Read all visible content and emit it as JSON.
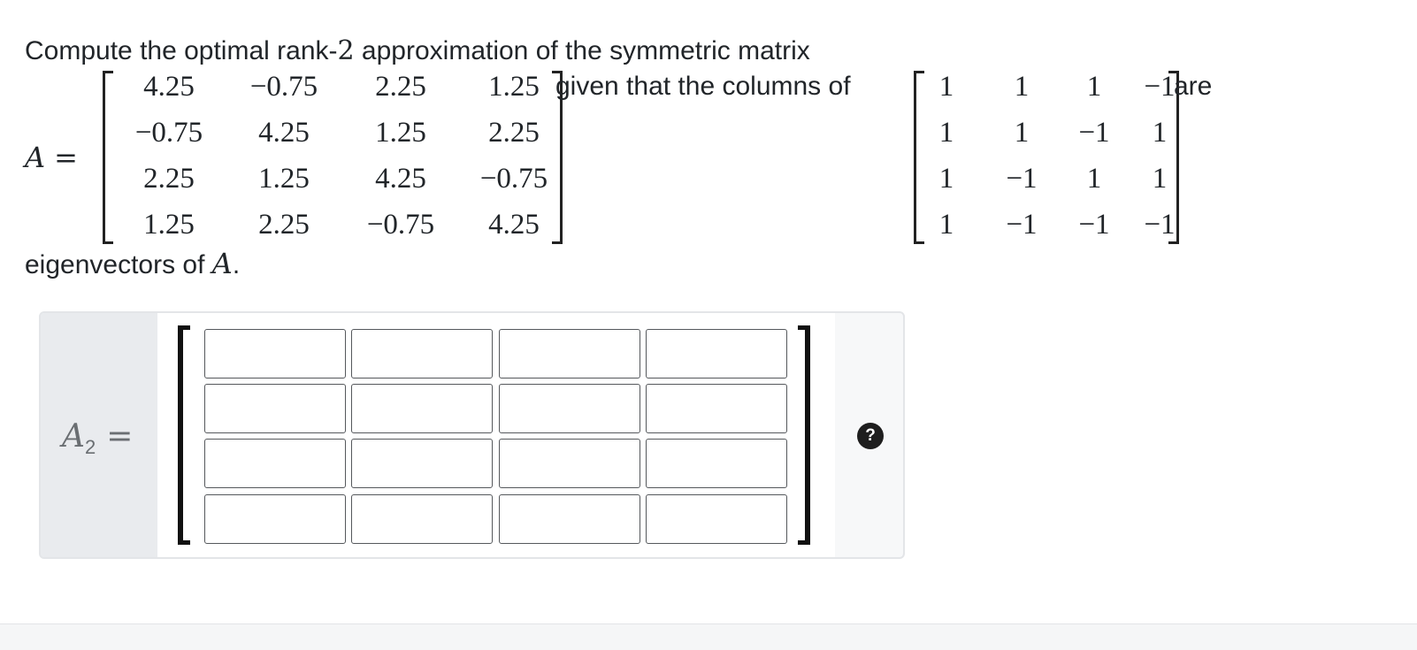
{
  "question": {
    "intro_text": "Compute the optimal rank-",
    "rank": "2",
    "intro_rest": " approximation of the symmetric matrix",
    "matrix_name": "A",
    "equals": "=",
    "matrix_A": [
      [
        "4.25",
        "−0.75",
        "2.25",
        "1.25"
      ],
      [
        "−0.75",
        "4.25",
        "1.25",
        "2.25"
      ],
      [
        "2.25",
        "1.25",
        "4.25",
        "−0.75"
      ],
      [
        "1.25",
        "2.25",
        "−0.75",
        "4.25"
      ]
    ],
    "given_text": "given that the columns of",
    "eigen_matrix": [
      [
        "1",
        "1",
        "1",
        "−1"
      ],
      [
        "1",
        "1",
        "−1",
        "1"
      ],
      [
        "1",
        "−1",
        "1",
        "1"
      ],
      [
        "1",
        "−1",
        "−1",
        "−1"
      ]
    ],
    "are_text": "are",
    "eig_text": "eigenvectors of ",
    "eig_var": "A",
    "eig_end": "."
  },
  "answer": {
    "label_var": "A",
    "label_sub": "2",
    "label_eq": "=",
    "inputs": [
      [
        "",
        "",
        "",
        ""
      ],
      [
        "",
        "",
        "",
        ""
      ],
      [
        "",
        "",
        "",
        ""
      ],
      [
        "",
        "",
        "",
        ""
      ]
    ],
    "help_label": "?"
  }
}
